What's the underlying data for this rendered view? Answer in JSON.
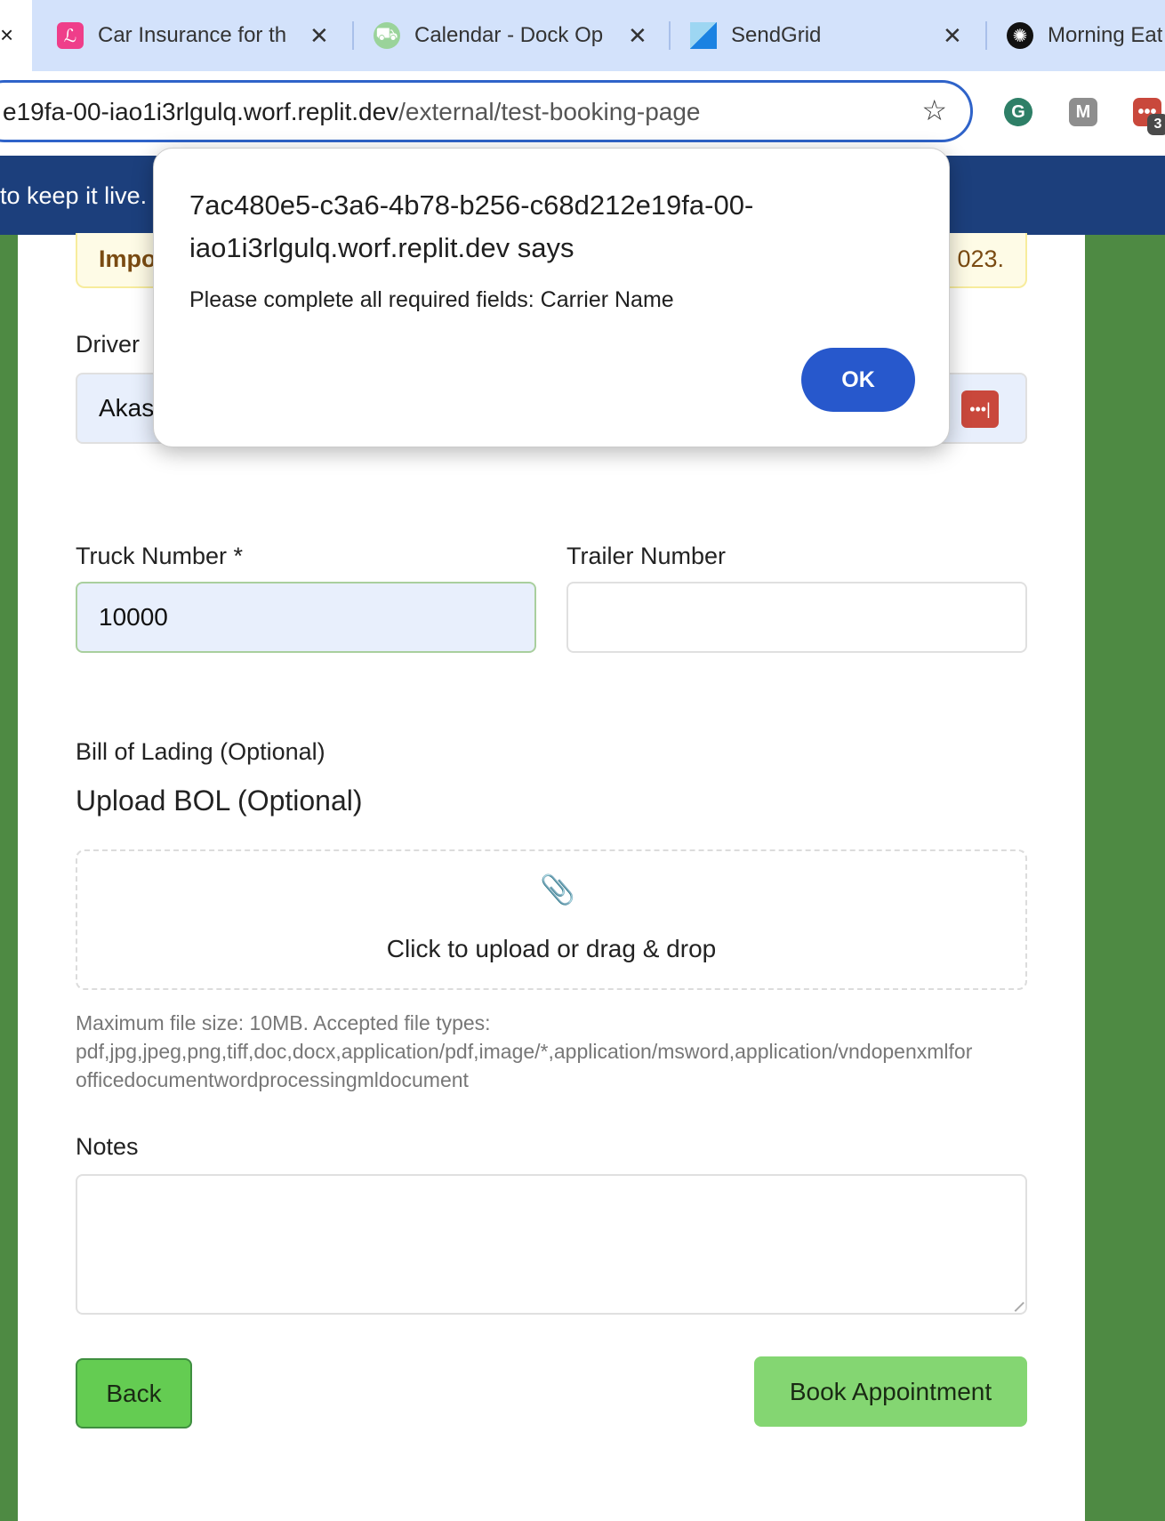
{
  "browser": {
    "active_tab_close": "×",
    "tabs": [
      {
        "title": "Car Insurance for th",
        "icon": "lemonade-icon"
      },
      {
        "title": "Calendar - Dock Op",
        "icon": "truck-icon"
      },
      {
        "title": "SendGrid",
        "icon": "sendgrid-icon"
      },
      {
        "title": "Morning Eat",
        "icon": "openai-icon"
      }
    ],
    "url_host": "e19fa-00-iao1i3rlgulq.worf.replit.dev",
    "url_path": "/external/test-booking-page",
    "extension_badge": "3"
  },
  "banner": {
    "text": "to keep it live."
  },
  "notice": {
    "prefix": "Impo",
    "suffix": "023."
  },
  "form": {
    "driver_label": "Driver",
    "driver_value": "Akas",
    "truck_label": "Truck Number *",
    "truck_value": "10000",
    "trailer_label": "Trailer Number",
    "trailer_value": "",
    "bol_label": "Bill of Lading (Optional)",
    "bol_heading": "Upload BOL (Optional)",
    "upload_text": "Click to upload or drag & drop",
    "help_lines": [
      "Maximum file size: 10MB. Accepted file types:",
      "pdf,jpg,jpeg,png,tiff,doc,docx,application/pdf,image/*,application/msword,application/vndopenxmlfor",
      "officedocumentwordprocessingmldocument"
    ],
    "notes_label": "Notes",
    "notes_value": "",
    "back_label": "Back",
    "book_label": "Book Appointment"
  },
  "dialog": {
    "title_line1": "7ac480e5-c3a6-4b78-b256-c68d212e19fa-00-",
    "title_line2": "iao1i3rlgulq.worf.replit.dev says",
    "message": "Please complete all required fields: Carrier Name",
    "ok_label": "OK"
  }
}
